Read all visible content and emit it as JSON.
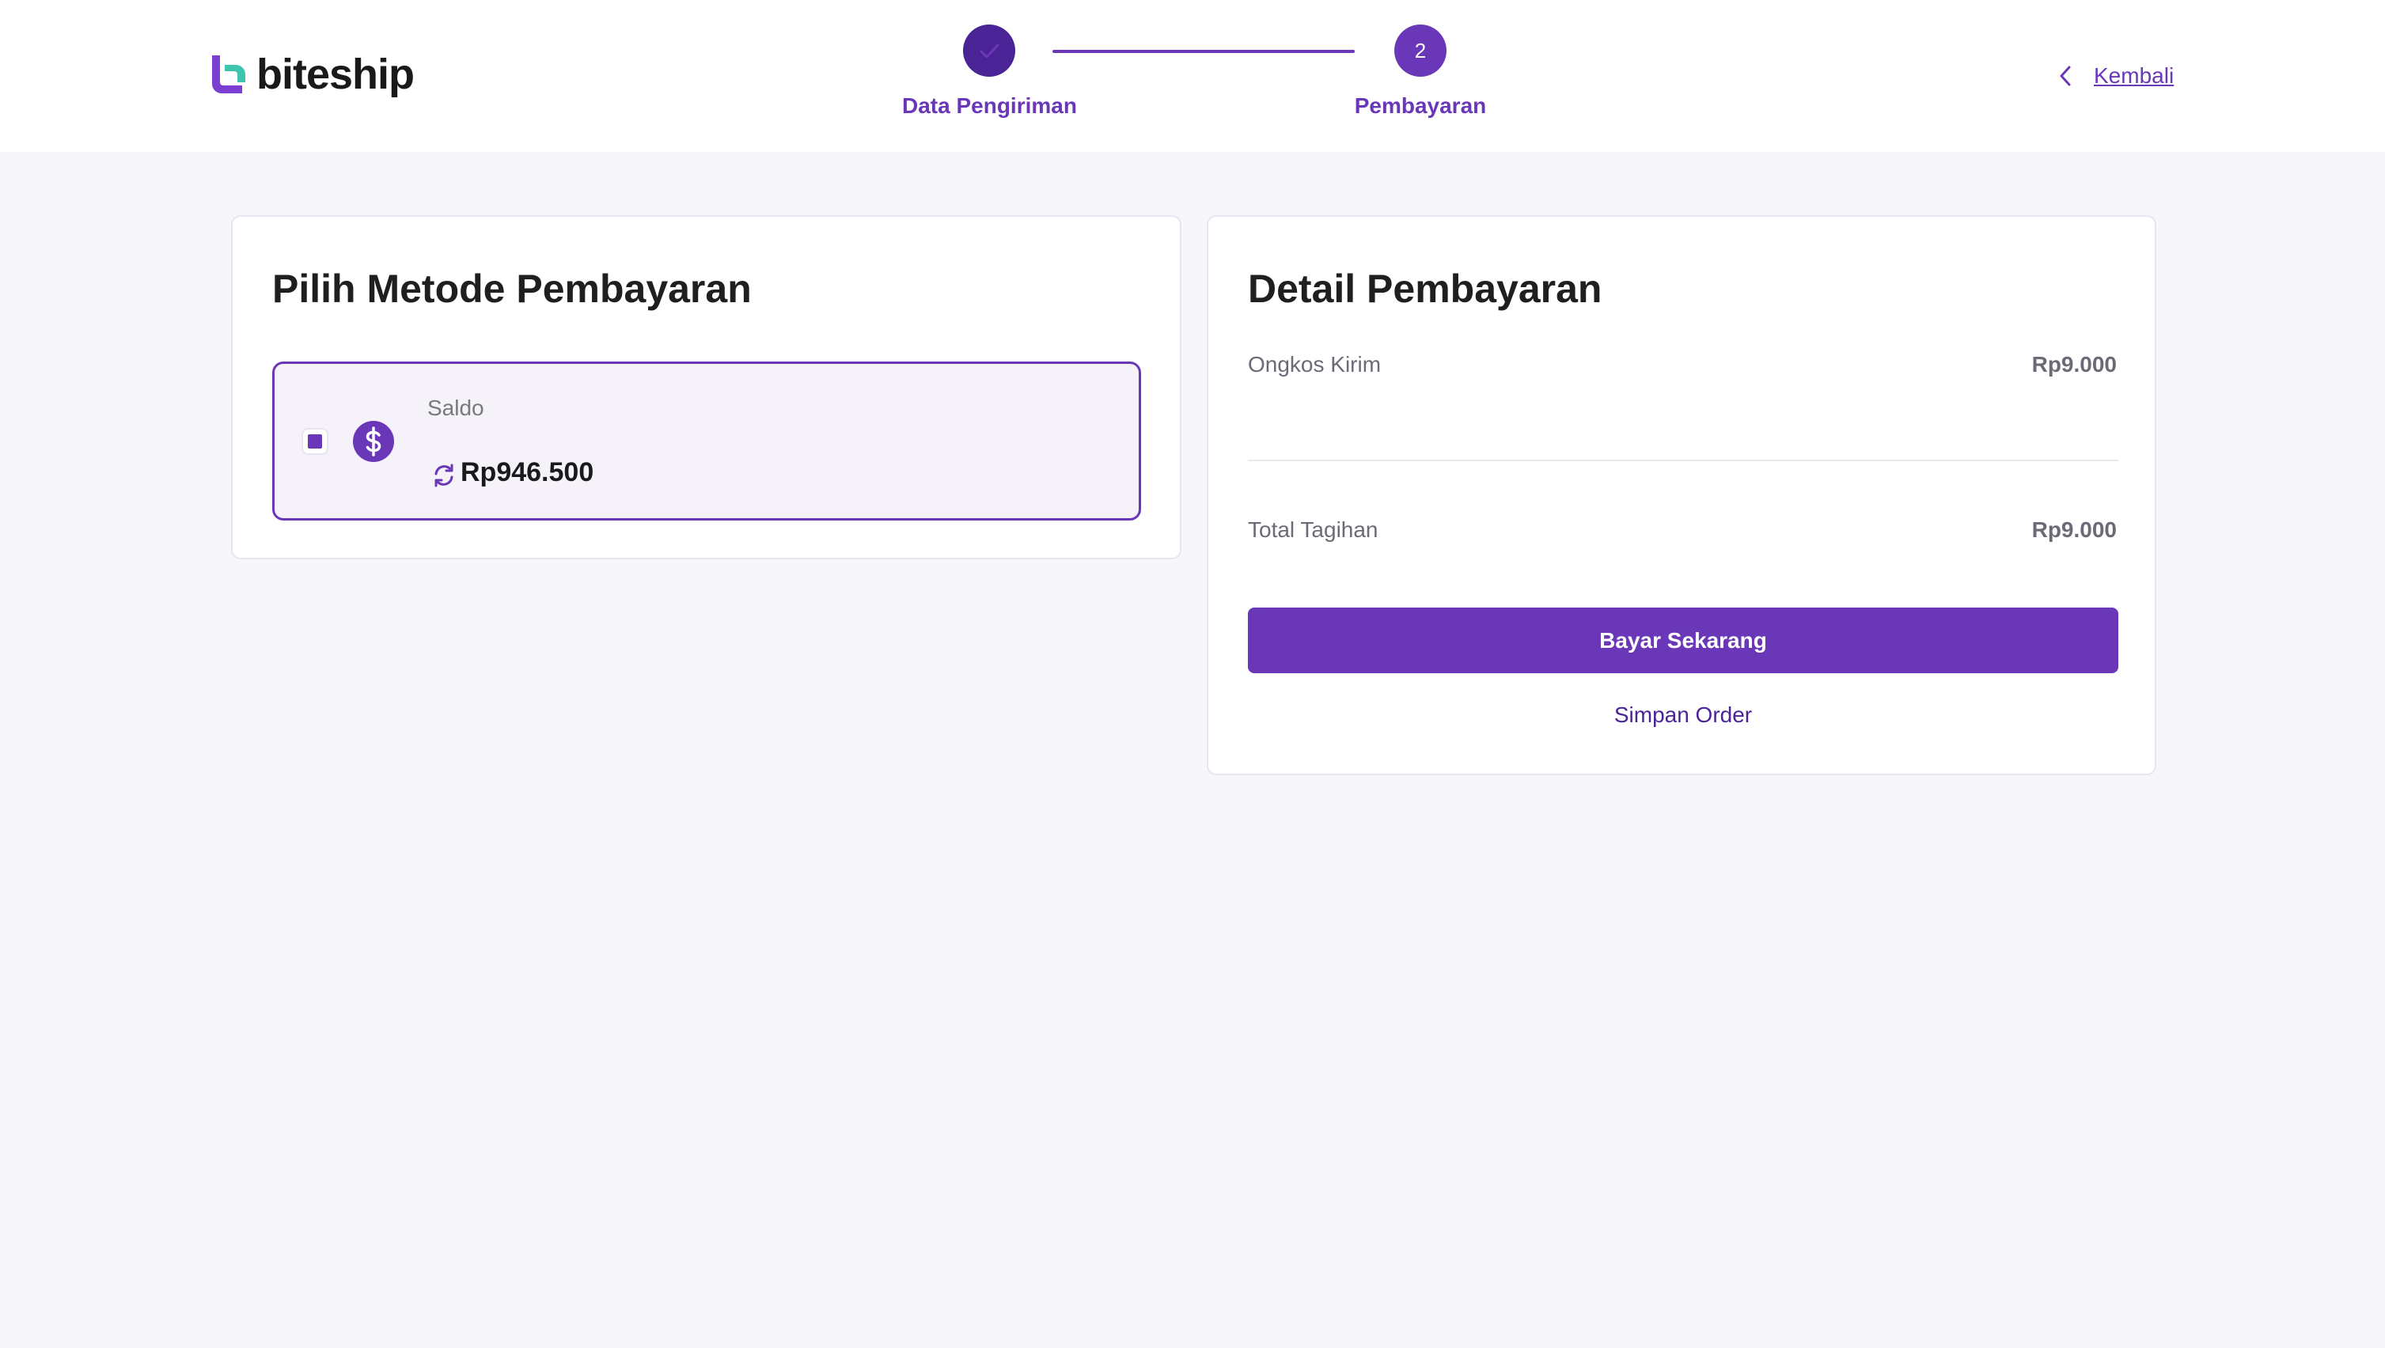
{
  "brand": {
    "name": "biteship"
  },
  "stepper": {
    "steps": [
      {
        "label": "Data Pengiriman",
        "state": "completed",
        "marker": "check-icon"
      },
      {
        "label": "Pembayaran",
        "state": "active",
        "number": "2"
      }
    ]
  },
  "nav": {
    "back_label": "Kembali"
  },
  "payment_method": {
    "title": "Pilih Metode Pembayaran",
    "options": [
      {
        "label": "Saldo",
        "amount": "Rp946.500",
        "selected": true,
        "icon": "dollar-icon"
      }
    ]
  },
  "payment_detail": {
    "title": "Detail Pembayaran",
    "shipping_cost_label": "Ongkos Kirim",
    "shipping_cost_value": "Rp9.000",
    "total_label": "Total Tagihan",
    "total_value": "Rp9.000",
    "pay_button": "Bayar Sekarang",
    "save_link": "Simpan Order"
  },
  "colors": {
    "accent": "#6a37b9",
    "accent_dark": "#4a2496",
    "logo_teal": "#3fc4b0",
    "background": "#f6f6fb"
  }
}
